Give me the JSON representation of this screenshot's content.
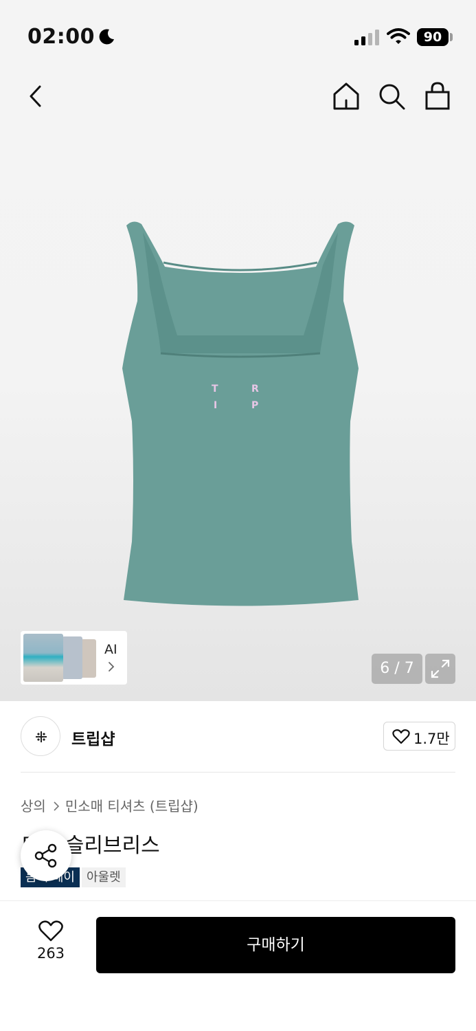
{
  "status_bar": {
    "time": "02:00",
    "battery": "90",
    "icons": [
      "moon-icon",
      "signal-icon",
      "wifi-icon",
      "battery-icon"
    ]
  },
  "nav": {
    "icons": [
      "back-icon",
      "home-icon",
      "search-icon",
      "shopping-bag-icon"
    ]
  },
  "gallery": {
    "counter": "6 / 7",
    "ai_label": "AI",
    "product_print": [
      "T",
      "R",
      "I",
      "P"
    ],
    "product_color": "#6a9e98"
  },
  "brand": {
    "name": "트립샵",
    "likes": "1.7만"
  },
  "product": {
    "breadcrumb": [
      "상의",
      "민소매 티셔츠 (트립샵)"
    ],
    "title": "트립 슬리브리스",
    "tags": [
      "봄 투데이",
      "아울렛"
    ]
  },
  "bottom": {
    "wish_count": "263",
    "buy_label": "구매하기"
  },
  "colors": {
    "buy_button": "#000000",
    "tag_dark": "#0a2f53",
    "tag_light": "#f1f1f1"
  }
}
